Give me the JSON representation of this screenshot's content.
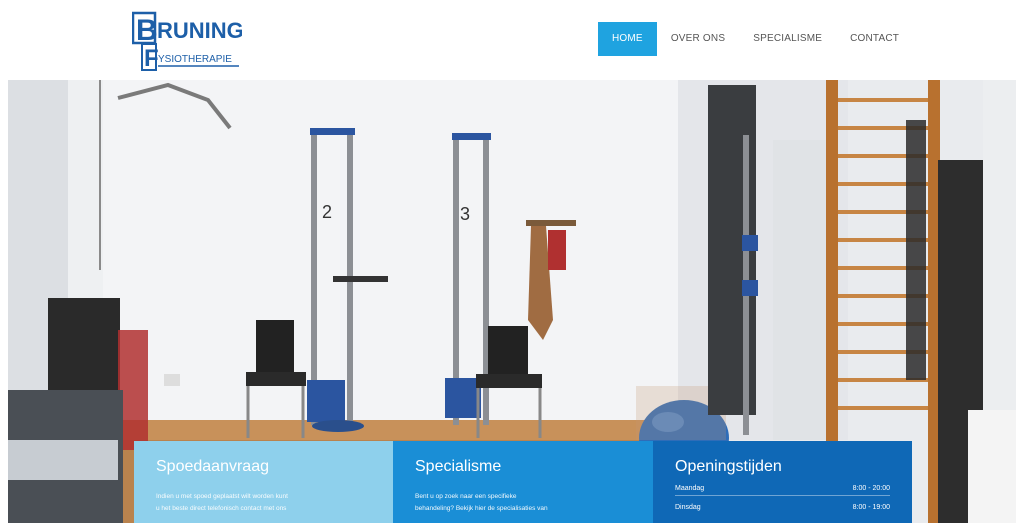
{
  "logo": {
    "line1": "RUNING",
    "line1_initial": "B",
    "line2_initial": "F",
    "line2": "YSIOTHERAPIE"
  },
  "nav": {
    "items": [
      {
        "label": "HOME",
        "active": true
      },
      {
        "label": "OVER ONS",
        "active": false
      },
      {
        "label": "SPECIALISME",
        "active": false
      },
      {
        "label": "CONTACT",
        "active": false
      }
    ]
  },
  "hero": {
    "station_numbers": [
      "2",
      "3"
    ]
  },
  "boxes": {
    "spoed": {
      "title": "Spoedaanvraag",
      "text_line1": "Indien u met spoed geplaatst wilt worden kunt",
      "text_line2": "u het beste direct telefonisch contact met ons"
    },
    "specialisme": {
      "title": "Specialisme",
      "text_line1": "Bent u op zoek naar een specifieke",
      "text_line2": "behandeling? Bekijk hier de specialisaties van"
    },
    "openingstijden": {
      "title": "Openingstijden",
      "rows": [
        {
          "day": "Maandag",
          "hours": "8:00 - 20:00"
        },
        {
          "day": "Dinsdag",
          "hours": "8:00 - 19:00"
        }
      ]
    }
  },
  "colors": {
    "nav_active": "#1fa3e0",
    "box1": "#8ed0ec",
    "box2": "#1a8ed6",
    "box3": "#0f68b6",
    "logo_blue": "#1d5fa8"
  }
}
